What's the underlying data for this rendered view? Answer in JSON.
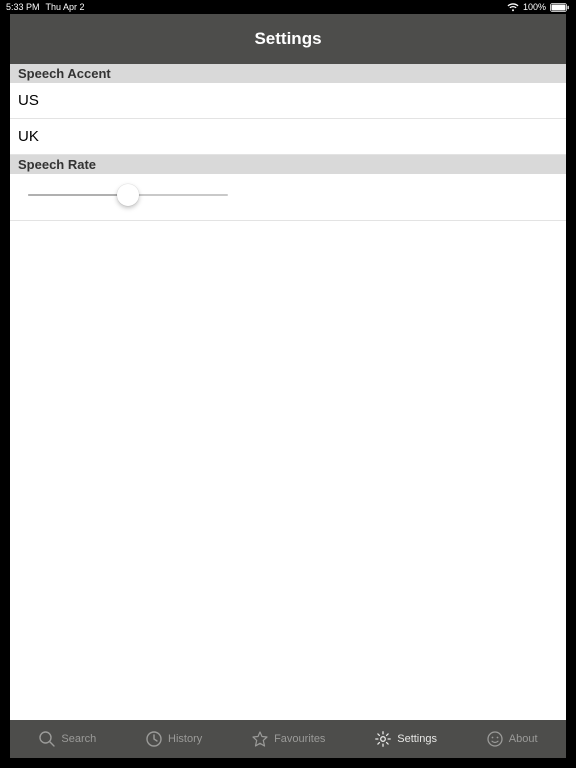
{
  "status_bar": {
    "time": "5:33 PM",
    "date": "Thu Apr 2",
    "battery_percent": "100%"
  },
  "header": {
    "title": "Settings"
  },
  "sections": {
    "accent_header": "Speech Accent",
    "accent_items": [
      "US",
      "UK"
    ],
    "rate_header": "Speech Rate"
  },
  "slider": {
    "value_percent": 50
  },
  "tabs": {
    "search": "Search",
    "history": "History",
    "favourites": "Favourites",
    "settings": "Settings",
    "about": "About"
  }
}
